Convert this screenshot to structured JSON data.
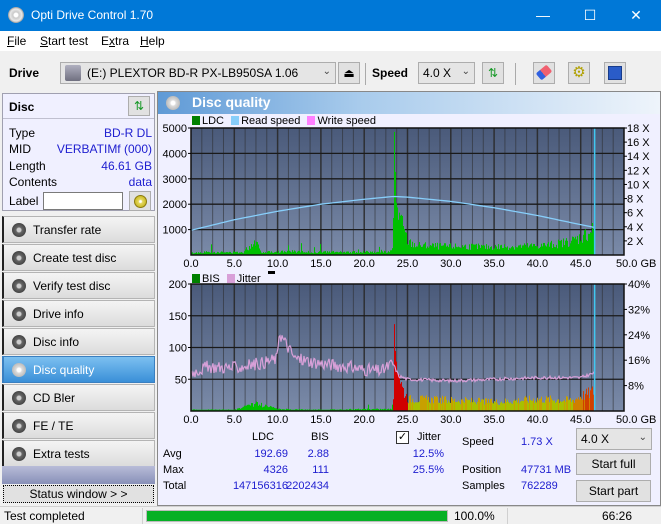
{
  "window": {
    "title": "Opti Drive Control 1.70",
    "minimize": "—",
    "maximize": "☐",
    "close": "✕"
  },
  "menu": [
    {
      "pre": "",
      "u": "F",
      "post": "ile"
    },
    {
      "pre": "",
      "u": "S",
      "post": "tart test"
    },
    {
      "pre": "E",
      "u": "x",
      "post": "tra"
    },
    {
      "pre": "",
      "u": "H",
      "post": "elp"
    }
  ],
  "toolbar": {
    "drive_label": "Drive",
    "drive_value": "(E:)  PLEXTOR BD-R  PX-LB950SA 1.06",
    "speed_label": "Speed",
    "speed_value": "4.0 X"
  },
  "disc": {
    "header": "Disc",
    "fields": [
      {
        "key": "Type",
        "value": "BD-R DL"
      },
      {
        "key": "MID",
        "value": "VERBATIMf (000)"
      },
      {
        "key": "Length",
        "value": "46.61 GB"
      },
      {
        "key": "Contents",
        "value": "data"
      }
    ],
    "label_key": "Label",
    "label_value": ""
  },
  "nav": [
    {
      "label": "Transfer rate",
      "active": false
    },
    {
      "label": "Create test disc",
      "active": false
    },
    {
      "label": "Verify test disc",
      "active": false
    },
    {
      "label": "Drive info",
      "active": false
    },
    {
      "label": "Disc info",
      "active": false
    },
    {
      "label": "Disc quality",
      "active": true
    },
    {
      "label": "CD Bler",
      "active": false
    },
    {
      "label": "FE / TE",
      "active": false
    },
    {
      "label": "Extra tests",
      "active": false
    }
  ],
  "status_window_label": "Status window > >",
  "panel_title": "Disc quality",
  "colors": {
    "ldc": "#00c000",
    "read_speed": "#87cefa",
    "write_speed": "#ff80ff",
    "bis": "#008000",
    "jitter": "#d8a0d8",
    "plot_bg_top": "#4a5a7a",
    "plot_bg_bottom": "#7a8aa8"
  },
  "chart_data": [
    {
      "type": "bar",
      "title": "LDC / Read speed",
      "legend": [
        {
          "name": "LDC",
          "color": "#008000"
        },
        {
          "name": "Read speed",
          "color": "#87cefa"
        },
        {
          "name": "Write speed",
          "color": "#ff80ff"
        }
      ],
      "xlabel": "GB",
      "xlim": [
        0,
        50
      ],
      "x_ticks": [
        "0.0",
        "5.0",
        "10.0",
        "15.0",
        "20.0",
        "25.0",
        "30.0",
        "35.0",
        "40.0",
        "45.0",
        "50.0 GB"
      ],
      "ylim": [
        0,
        5000
      ],
      "y_ticks": [
        "5000",
        "4000",
        "3000",
        "2000",
        "1000"
      ],
      "y2lim": [
        0,
        18
      ],
      "y2_ticks": [
        "18 X",
        "16 X",
        "14 X",
        "12 X",
        "10 X",
        "8 X",
        "6 X",
        "4 X",
        "2 X"
      ],
      "grid": true,
      "ldc_series": {
        "x": [
          0,
          2,
          4,
          6,
          7.5,
          8,
          10,
          12,
          14,
          16,
          18,
          20,
          22,
          23.3,
          23.4,
          23.6,
          23.8,
          24,
          24.3,
          24.6,
          25,
          26,
          28,
          30,
          32,
          34,
          36,
          38,
          40,
          42,
          44,
          45,
          46,
          46.6
        ],
        "y": [
          80,
          120,
          100,
          110,
          600,
          120,
          130,
          140,
          110,
          120,
          100,
          130,
          110,
          150,
          4326,
          2500,
          1800,
          1500,
          1200,
          900,
          500,
          380,
          350,
          330,
          340,
          310,
          330,
          340,
          360,
          420,
          560,
          700,
          900,
          1200
        ]
      },
      "read_speed_series": {
        "x": [
          0,
          5,
          10,
          15,
          20,
          23.4,
          25,
          30,
          35,
          40,
          45,
          46.6
        ],
        "y": [
          3.5,
          5.0,
          6.2,
          7.2,
          7.9,
          8.3,
          8.2,
          7.6,
          6.7,
          5.6,
          4.3,
          3.9
        ]
      },
      "end_marker_x": 46.61
    },
    {
      "type": "bar",
      "title": "BIS / Jitter",
      "legend": [
        {
          "name": "BIS",
          "color": "#008000"
        },
        {
          "name": "Jitter",
          "color": "#d8a0d8"
        }
      ],
      "xlabel": "GB",
      "xlim": [
        0,
        50
      ],
      "x_ticks": [
        "0.0",
        "5.0",
        "10.0",
        "15.0",
        "20.0",
        "25.0",
        "30.0",
        "35.0",
        "40.0",
        "45.0",
        "50.0 GB"
      ],
      "ylim": [
        0,
        200
      ],
      "y_ticks": [
        "200",
        "150",
        "100",
        "50"
      ],
      "y2lim": [
        0,
        40
      ],
      "y2_ticks": [
        "40%",
        "32%",
        "24%",
        "16%",
        "8%"
      ],
      "grid": true,
      "bis_series": {
        "x": [
          0,
          5,
          7.5,
          10,
          15,
          20,
          23.3,
          23.4,
          23.8,
          24.3,
          25,
          30,
          35,
          40,
          44,
          45,
          46,
          46.6
        ],
        "y": [
          2,
          2,
          12,
          3,
          2,
          3,
          3,
          111,
          85,
          40,
          20,
          18,
          15,
          20,
          18,
          25,
          30,
          35
        ]
      },
      "jitter_series": {
        "x": [
          0,
          2,
          5,
          8,
          10,
          10.1,
          12,
          15,
          18,
          20,
          22,
          23.3,
          24,
          25,
          30,
          35,
          40,
          45,
          46.6
        ],
        "y": [
          12,
          14,
          13.5,
          15,
          16.5,
          25,
          16.5,
          15,
          14,
          13,
          12.5,
          15,
          11,
          10,
          9.5,
          10,
          10.5,
          10.5,
          12
        ]
      },
      "end_marker_x": 46.61
    }
  ],
  "stats": {
    "col_ldc": "LDC",
    "col_bis": "BIS",
    "jitter_label": "Jitter",
    "jitter_checked": true,
    "rows": [
      {
        "label": "Avg",
        "ldc": "192.69",
        "bis": "2.88",
        "jitter": "12.5%"
      },
      {
        "label": "Max",
        "ldc": "4326",
        "bis": "111",
        "jitter": "25.5%"
      },
      {
        "label": "Total",
        "ldc": "147156316",
        "bis": "2202434",
        "jitter": ""
      }
    ],
    "speed_label": "Speed",
    "speed_value": "1.73 X",
    "position_label": "Position",
    "position_value": "47731 MB",
    "samples_label": "Samples",
    "samples_value": "762289",
    "speed_select": "4.0 X",
    "start_full": "Start full",
    "start_part": "Start part"
  },
  "statusbar": {
    "text": "Test completed",
    "progress": 1.0,
    "percent": "100.0%",
    "elapsed": "66:26"
  }
}
